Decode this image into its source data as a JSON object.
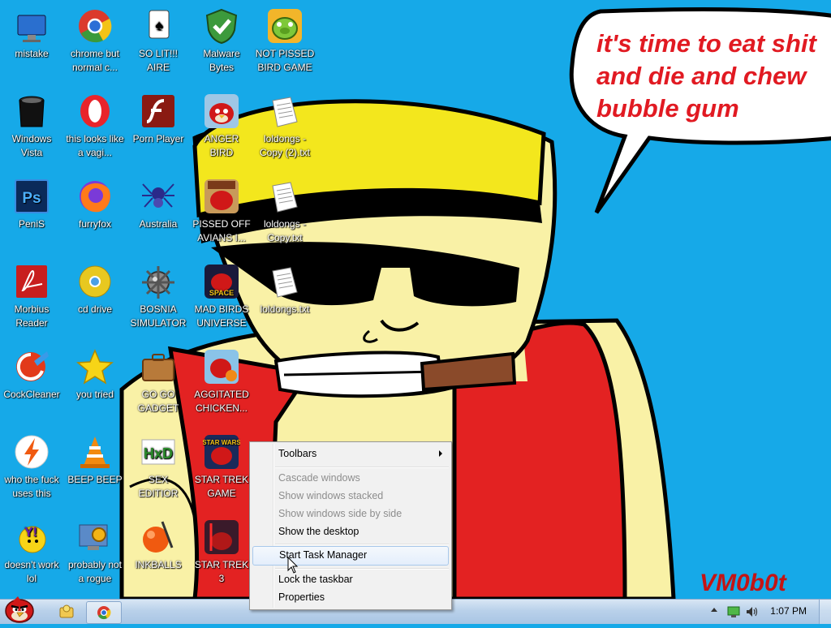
{
  "desktop": {
    "speech_bubble": {
      "line1": "it's time to eat shit",
      "line2": "and die and chew",
      "line3": "bubble gum"
    },
    "signature": "VM0b0t",
    "icons": [
      {
        "label": "mistake",
        "icon": "computer-icon"
      },
      {
        "label": "chrome but normal c...",
        "icon": "chrome-icon"
      },
      {
        "label": "SO LIT!!! AIRE",
        "icon": "solitaire-icon"
      },
      {
        "label": "Malware Bytes",
        "icon": "shield-icon"
      },
      {
        "label": "NOT PISSED BIRD GAME",
        "icon": "pig-icon"
      },
      {
        "label": "Windows Vista",
        "icon": "trash-icon"
      },
      {
        "label": "this looks like a vagi...",
        "icon": "opera-icon"
      },
      {
        "label": "Porn Player",
        "icon": "flash-icon"
      },
      {
        "label": "ANGER BIRD",
        "icon": "red-bird-icon"
      },
      {
        "label": "loldongs - Copy (2).txt",
        "icon": "text-file-icon"
      },
      {
        "label": "PeniS",
        "icon": "photoshop-icon"
      },
      {
        "label": "furryfox",
        "icon": "firefox-icon"
      },
      {
        "label": "Australia",
        "icon": "spider-icon"
      },
      {
        "label": "PISSED OFF AVIANS I...",
        "icon": "seasons-icon"
      },
      {
        "label": "loldongs - Copy.txt",
        "icon": "text-file-icon"
      },
      {
        "label": "Morbius Reader",
        "icon": "pdf-icon"
      },
      {
        "label": "cd drive",
        "icon": "cd-icon"
      },
      {
        "label": "BOSNIA SIMULATOR",
        "icon": "mine-icon"
      },
      {
        "label": "MAD BIRDS UNIVERSE",
        "icon": "space-bird-icon"
      },
      {
        "label": "loldongs.txt",
        "icon": "text-file-icon"
      },
      {
        "label": "CockCleaner",
        "icon": "ccleaner-icon"
      },
      {
        "label": "you tried",
        "icon": "star-icon"
      },
      {
        "label": "GO GO GADGET",
        "icon": "briefcase-icon"
      },
      {
        "label": "AGGITATED CHICKEN...",
        "icon": "rio-bird-icon"
      },
      {
        "label": "who the fuck uses this",
        "icon": "lightning-icon"
      },
      {
        "label": "BEEP BEEP",
        "icon": "vlc-cone-icon"
      },
      {
        "label": "SEX EDITIOR",
        "icon": "hxd-icon"
      },
      {
        "label": "STAR TREK GAME",
        "icon": "star-wars-bird-icon"
      },
      {
        "label": "doesn't work lol",
        "icon": "yahoo-icon"
      },
      {
        "label": "probably not a rogue",
        "icon": "monitor-gears-icon"
      },
      {
        "label": "INKBALLS",
        "icon": "inkball-icon"
      },
      {
        "label": "STAR TREK 3",
        "icon": "star-wars-bird-2-icon"
      }
    ]
  },
  "context_menu": {
    "items": [
      {
        "label": "Toolbars",
        "state": "submenu"
      },
      {
        "label": "Cascade windows",
        "state": "disabled"
      },
      {
        "label": "Show windows stacked",
        "state": "disabled"
      },
      {
        "label": "Show windows side by side",
        "state": "disabled"
      },
      {
        "label": "Show the desktop",
        "state": "enabled"
      },
      {
        "label": "Start Task Manager",
        "state": "hover"
      },
      {
        "label": "Lock the taskbar",
        "state": "enabled"
      },
      {
        "label": "Properties",
        "state": "enabled"
      }
    ]
  },
  "taskbar": {
    "clock": "1:07 PM",
    "start_icon": "angry-bird-start-icon",
    "pinned": [
      "explorer-icon",
      "chrome-icon"
    ],
    "tray_icons": [
      "show-hidden-icons-arrow",
      "network-icon",
      "volume-icon"
    ]
  },
  "colors": {
    "desktop_bg": "#16a9e8",
    "speech_text": "#e11a22",
    "skin": "#f9f1a6",
    "shirt": "#e32222",
    "hair": "#f3e71d",
    "cigar": "#8a4a2a"
  }
}
